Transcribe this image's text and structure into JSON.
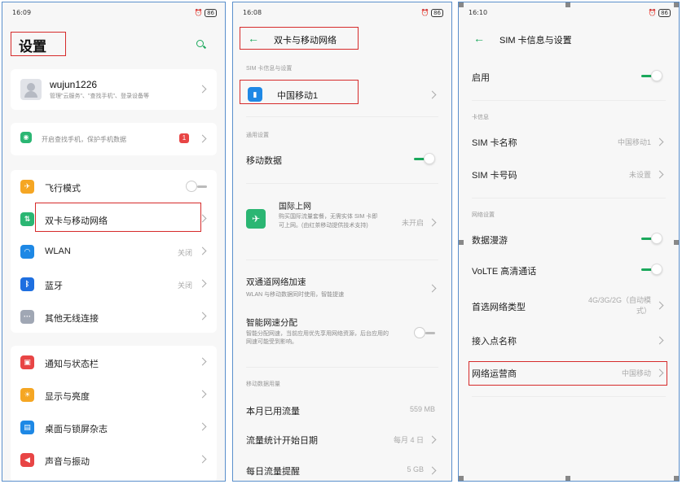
{
  "panel1": {
    "status": {
      "time": "16:09",
      "signal": "∷ıl",
      "battery": "86"
    },
    "title": "设置",
    "account": {
      "name": "wujun1226",
      "subtitle": "管理\"云服务\"、\"查找手机\"、登录设备等"
    },
    "find_phone": {
      "text": "开启查找手机，保护手机数据",
      "badge": "1"
    },
    "items": [
      {
        "label": "飞行模式",
        "icon": "airplane-icon",
        "color": "#f5a623"
      },
      {
        "label": "双卡与移动网络",
        "icon": "sim-network-icon",
        "color": "#2bb673"
      },
      {
        "label": "WLAN",
        "value": "关闭",
        "icon": "wifi-icon",
        "color": "#1e88e5"
      },
      {
        "label": "蓝牙",
        "value": "关闭",
        "icon": "bluetooth-icon",
        "color": "#1e6fe0"
      },
      {
        "label": "其他无线连接",
        "icon": "more-connections-icon",
        "color": "#a0a7b4"
      },
      {
        "label": "通知与状态栏",
        "icon": "notification-icon",
        "color": "#e84545"
      },
      {
        "label": "显示与亮度",
        "icon": "brightness-icon",
        "color": "#f5a623"
      },
      {
        "label": "桌面与锁屏杂志",
        "icon": "wallpaper-icon",
        "color": "#1e88e5"
      },
      {
        "label": "声音与振动",
        "icon": "sound-icon",
        "color": "#e84545"
      }
    ]
  },
  "panel2": {
    "status": {
      "time": "16:08",
      "battery": "86"
    },
    "title": "双卡与移动网络",
    "sim_section": "SIM 卡信息与设置",
    "sim_name": "中国移动1",
    "general_section": "通用设置",
    "mobile_data": "移动数据",
    "intl": {
      "title": "国际上网",
      "desc": "购买国际流量套餐，无需实体 SIM 卡即可上网。(由红茶移动提供技术支持)",
      "value": "未开启"
    },
    "dual_channel": {
      "title": "双通道网络加速",
      "desc": "WLAN 与移动数据同时使用，智能提速"
    },
    "smart_speed": {
      "title": "智能网速分配",
      "desc": "智能分配网速，当前应用优先享用网络资源，后台应用的网速可能受到影响。"
    },
    "usage_section": "移动数据用量",
    "usage_items": [
      {
        "label": "本月已用流量",
        "value": "559 MB"
      },
      {
        "label": "流量统计开始日期",
        "value": "每月 4 日"
      },
      {
        "label": "每日流量提醒",
        "value": "5 GB"
      }
    ]
  },
  "panel3": {
    "status": {
      "time": "16:10",
      "battery": "86"
    },
    "title": "SIM 卡信息与设置",
    "enable": "启用",
    "card_section": "卡信息",
    "sim_name_label": "SIM 卡名称",
    "sim_name_value": "中国移动1",
    "sim_number_label": "SIM 卡号码",
    "sim_number_value": "未设置",
    "network_section": "网络设置",
    "roaming": "数据漫游",
    "volte": "VoLTE 高清通话",
    "pref_network": "首选网络类型",
    "pref_network_value_1": "4G/3G/2G（自动模",
    "pref_network_value_2": "式）",
    "apn": "接入点名称",
    "operator": "网络运营商",
    "operator_value": "中国移动"
  }
}
